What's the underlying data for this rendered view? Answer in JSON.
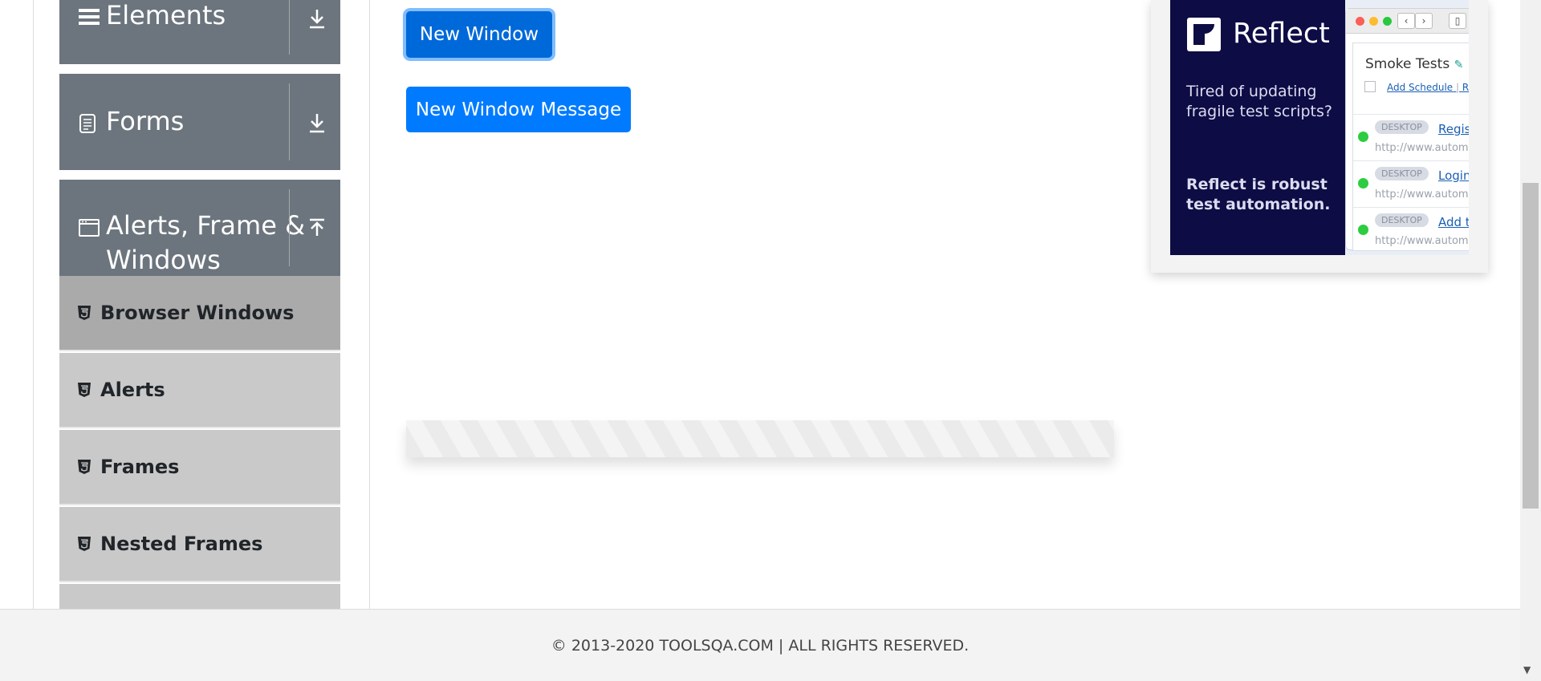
{
  "sidebar": {
    "groups": [
      {
        "label": "Elements",
        "icon": "hamburger-icon",
        "arrow": "download-arrow-icon"
      },
      {
        "label": "Forms",
        "icon": "document-icon",
        "arrow": "download-arrow-icon"
      },
      {
        "label_line1": "Alerts, Frame &",
        "label_line2": "Windows",
        "icon": "window-icon",
        "arrow": "upload-arrow-icon"
      }
    ],
    "items": [
      {
        "label": "Browser Windows",
        "active": true
      },
      {
        "label": "Alerts"
      },
      {
        "label": "Frames"
      },
      {
        "label": "Nested Frames"
      }
    ]
  },
  "main": {
    "new_window_label": "New Window",
    "new_window_message_label": "New Window Message"
  },
  "ad": {
    "brand": "Reflect",
    "tagline": "Tired of updating fragile test scripts?",
    "pitch": "Reflect is robust test automation.",
    "suite_title": "Smoke Tests",
    "add_schedule": "Add Schedule",
    "run_link": "Ru",
    "rows": [
      {
        "badge": "DESKTOP",
        "link": "Registr",
        "url": "http://www.automat"
      },
      {
        "badge": "DESKTOP",
        "link": "Login",
        "url": "http://www.automat"
      },
      {
        "badge": "DESKTOP",
        "link": "Add to",
        "url": "http://www.automat"
      }
    ]
  },
  "footer": {
    "text": "© 2013-2020 TOOLSQA.COM | ALL RIGHTS RESERVED."
  },
  "colors": {
    "primary": "#007bff",
    "sidebar_group": "#6c757d",
    "sidebar_item": "#c9c9c9",
    "sidebar_item_active": "#aaaaaa",
    "ad_navy": "#0d0c45"
  }
}
